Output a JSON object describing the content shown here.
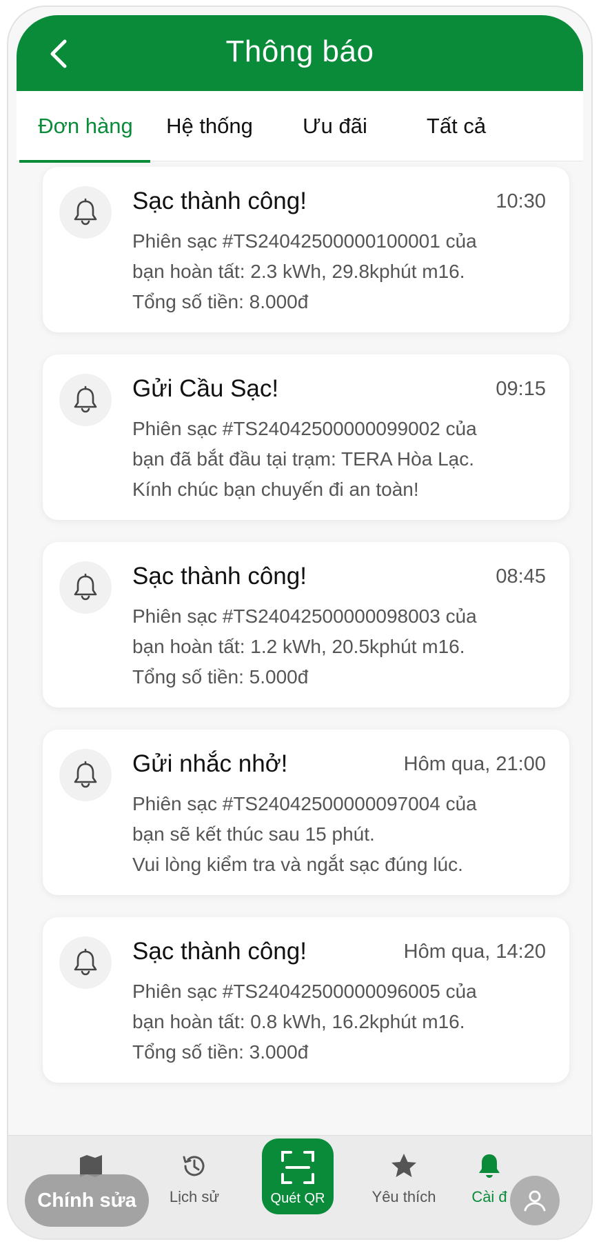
{
  "header": {
    "title": "Thông báo",
    "back_icon": "chevron-left-icon",
    "background": "#0a8b3a"
  },
  "tabs": [
    {
      "label": "Đơn hàng",
      "active": true
    },
    {
      "label": "Hệ thống",
      "active": false
    },
    {
      "label": "Ưu đãi",
      "active": false
    },
    {
      "label": "Tất cả",
      "active": false
    }
  ],
  "notifications": [
    {
      "icon": "bell-icon",
      "title": "Sạc thành công!",
      "time": "10:30",
      "body": "Phiên sạc #TS24042500000100001 của\nbạn hoàn tất: 2.3 kWh, 29.8kphút m16.\nTổng số tiền: 8.000đ"
    },
    {
      "icon": "bell-icon",
      "title": "Gửi Cầu Sạc!",
      "time": "09:15",
      "body": "Phiên sạc #TS24042500000099002 của\nbạn đã bắt đầu tại trạm: TERA Hòa Lạc.\nKính chúc bạn chuyến đi an toàn!"
    },
    {
      "icon": "bell-icon",
      "title": "Sạc thành công!",
      "time": "08:45",
      "body": "Phiên sạc #TS24042500000098003 của\nbạn hoàn tất: 1.2 kWh, 20.5kphút m16.\nTổng số tiền: 5.000đ"
    },
    {
      "icon": "bell-icon",
      "title": "Gửi nhắc nhở!",
      "time": "Hôm qua, 21:00",
      "body": "Phiên sạc #TS24042500000097004 của\nbạn sẽ kết thúc sau 15 phút.\nVui lòng kiểm tra và ngắt sạc đúng lúc."
    },
    {
      "icon": "bell-icon",
      "title": "Sạc thành công!",
      "time": "Hôm qua, 14:20",
      "body": "Phiên sạc #TS24042500000096005 của\nbạn hoàn tất: 0.8 kWh, 16.2kphút m16.\nTổng số tiền: 3.000đ"
    }
  ],
  "bottom_nav": {
    "items": [
      {
        "icon": "map-icon",
        "label": ""
      },
      {
        "icon": "history-icon",
        "label": "Lịch sử"
      },
      {
        "icon": "qr-scan-icon",
        "label": "Quét QR"
      },
      {
        "icon": "star-icon",
        "label": "Yêu thích"
      },
      {
        "icon": "bell-icon",
        "label": "Cài đ",
        "active": true
      }
    ],
    "edit_button": "Chính sửa",
    "profile_icon": "user-icon",
    "accent": "#0a8b3a"
  }
}
